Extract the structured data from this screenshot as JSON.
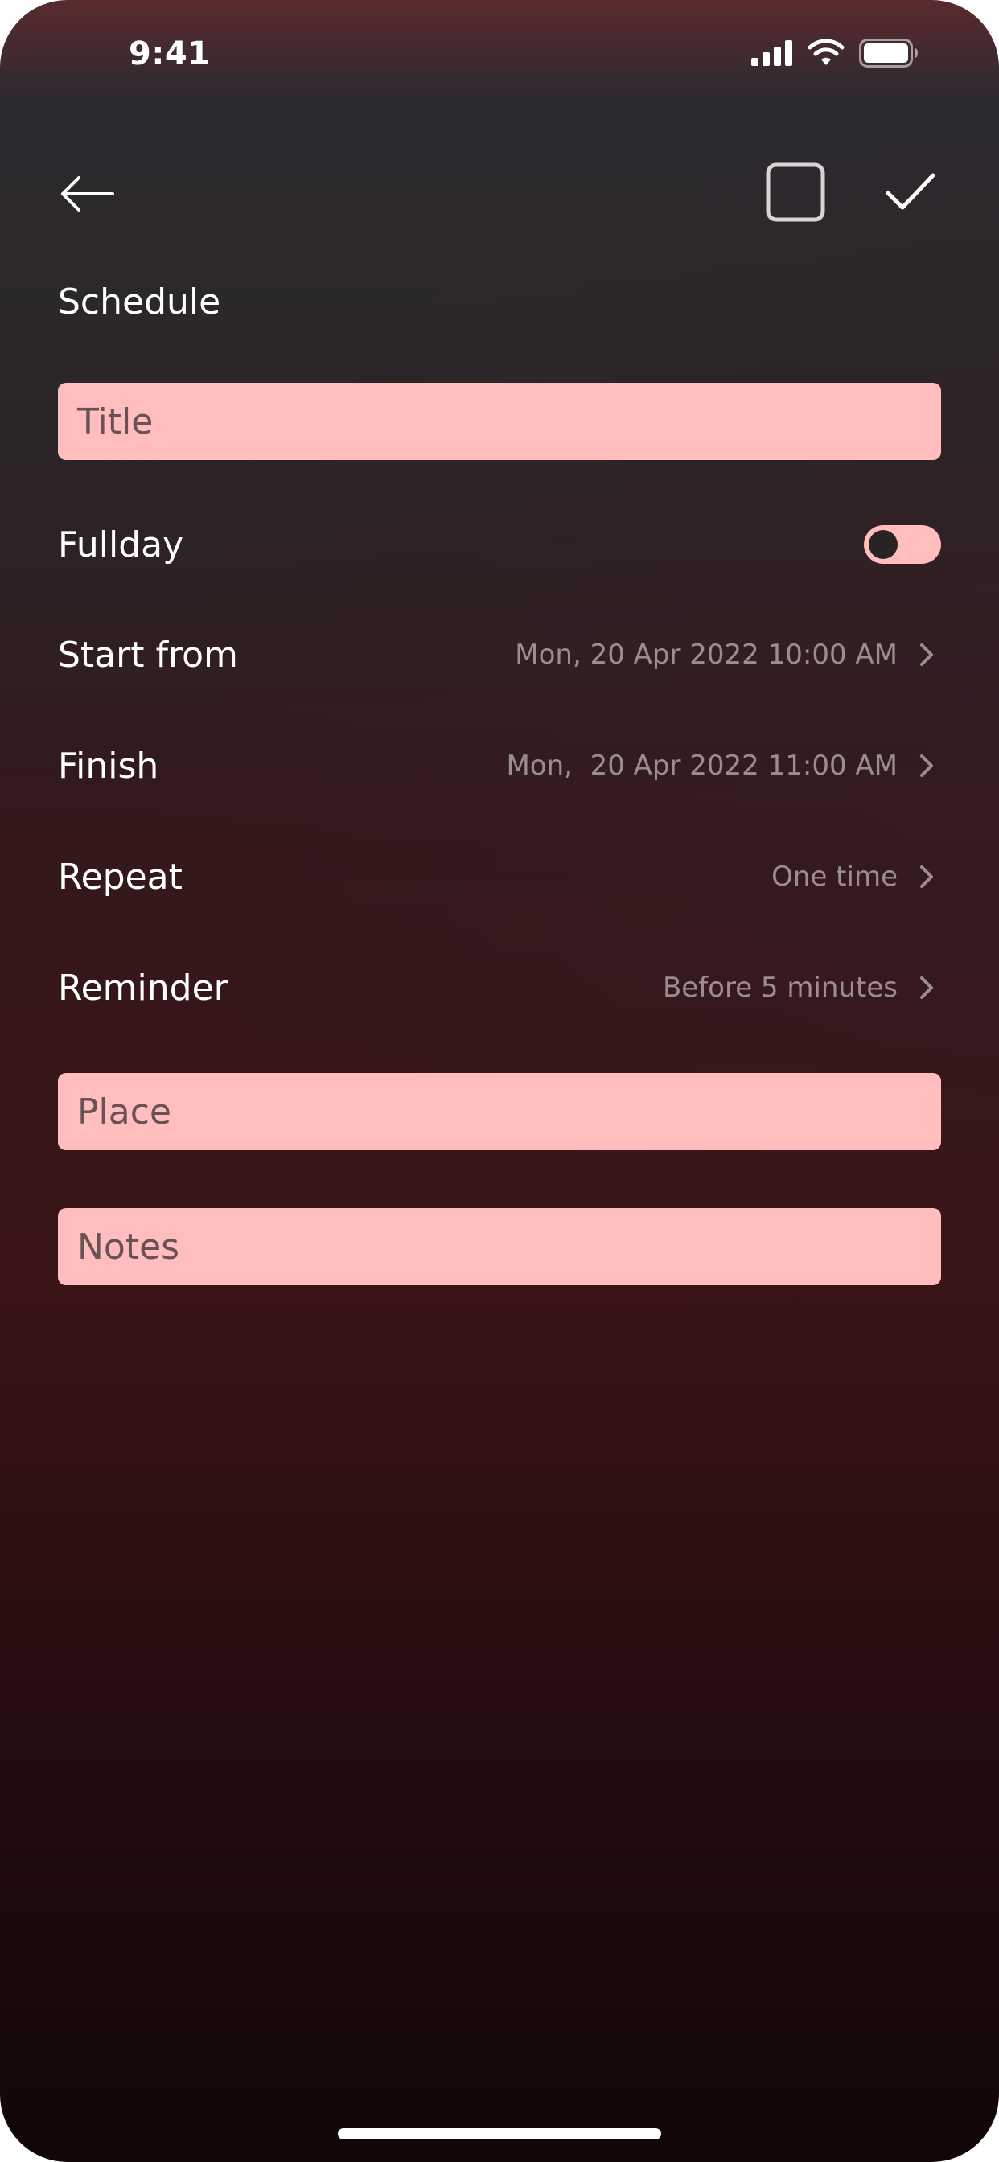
{
  "status_bar": {
    "time": "9:41",
    "icons": [
      "cellular-signal-icon",
      "wifi-icon",
      "battery-icon"
    ]
  },
  "nav": {
    "back_icon": "arrow-left-icon",
    "square_icon": "square-outline-icon",
    "confirm_icon": "checkmark-icon"
  },
  "page": {
    "title": "Schedule"
  },
  "form": {
    "title_placeholder": "Title",
    "fullday_label": "Fullday",
    "fullday_on": false,
    "start_label": "Start from",
    "start_value": "Mon, 20 Apr 2022 10:00 AM",
    "finish_label": "Finish",
    "finish_value": "Mon,  20 Apr 2022 11:00 AM",
    "repeat_label": "Repeat",
    "repeat_value": "One time",
    "reminder_label": "Reminder",
    "reminder_value": "Before 5 minutes",
    "place_placeholder": "Place",
    "notes_placeholder": "Notes"
  },
  "colors": {
    "field_background": "#ffbdbd",
    "secondary_text": "#9a8e8f",
    "primary_text": "#ffffff"
  }
}
